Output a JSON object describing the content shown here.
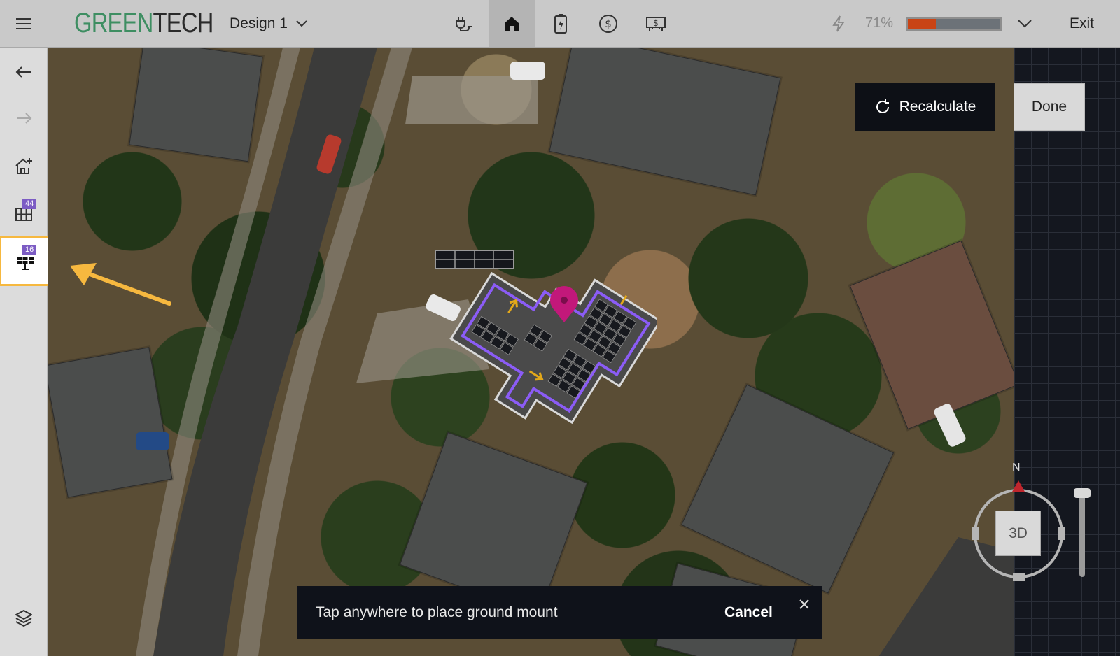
{
  "app": {
    "logo_part1": "GREEN",
    "logo_part2": "TECH",
    "design_name": "Design 1",
    "exit_label": "Exit"
  },
  "nav_tabs": [
    {
      "name": "electrical",
      "icon": "plug-icon",
      "active": false
    },
    {
      "name": "roof",
      "icon": "home-icon",
      "active": true
    },
    {
      "name": "battery",
      "icon": "battery-charge-icon",
      "active": false
    },
    {
      "name": "pricing",
      "icon": "dollar-circle-icon",
      "active": false
    },
    {
      "name": "financing",
      "icon": "dollar-bill-icon",
      "active": false
    }
  ],
  "energy": {
    "percent_label": "71%",
    "offset_fraction": 0.3,
    "accent": "#c94415"
  },
  "sidebar": {
    "items": [
      {
        "name": "undo",
        "icon": "undo-arrow-icon"
      },
      {
        "name": "redo",
        "icon": "redo-arrow-icon"
      },
      {
        "name": "add-structure",
        "icon": "add-home-icon"
      },
      {
        "name": "panels",
        "icon": "panel-grid-icon",
        "badge": "44"
      },
      {
        "name": "ground-mount",
        "icon": "ground-mount-icon",
        "badge": "16"
      },
      {
        "name": "layers",
        "icon": "layers-icon"
      }
    ]
  },
  "actions": {
    "recalculate_label": "Recalculate",
    "done_label": "Done"
  },
  "toast": {
    "message": "Tap anywhere to place ground mount",
    "cancel_label": "Cancel"
  },
  "compass": {
    "north_label": "N",
    "view_toggle_label": "3D"
  },
  "colors": {
    "brand_green": "#3e8e62",
    "highlight_orange": "#f6b83f",
    "badge_purple": "#7c5cc4",
    "roof_outline": "#8b5cf6",
    "pin_magenta": "#c2187a"
  }
}
